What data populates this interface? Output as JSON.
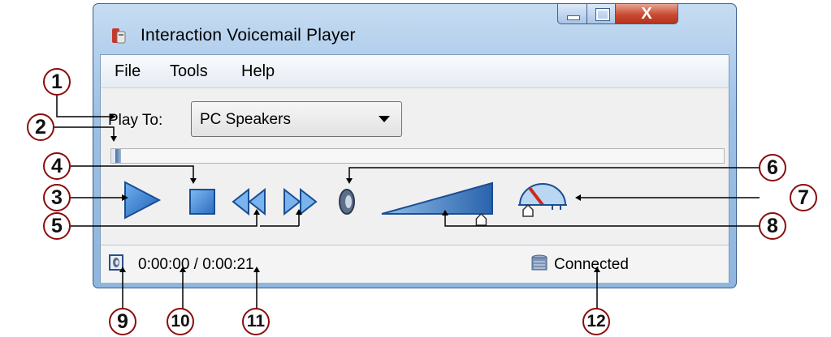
{
  "window": {
    "title": "Interaction Voicemail Player",
    "close_glyph": "X"
  },
  "menu": {
    "items": [
      "File",
      "Tools",
      "Help"
    ]
  },
  "play_to": {
    "label": "Play To:",
    "selected": "PC Speakers"
  },
  "playback": {
    "progress": 0.01,
    "elapsed": "0:00:00",
    "total": "0:00:21",
    "time_text": "0:00:00 / 0:00:21"
  },
  "volume": {
    "level": 0.9
  },
  "status": {
    "connection": "Connected"
  },
  "icons": {
    "app": "voicemail-app-icon",
    "play": "play-icon",
    "stop": "stop-icon",
    "rewind": "rewind-icon",
    "fast_forward": "fast-forward-icon",
    "speaker": "speaker-icon",
    "gain": "gain-meter-icon",
    "status": "speaker-status-icon",
    "server": "server-icon"
  },
  "callouts": [
    "1",
    "2",
    "3",
    "4",
    "5",
    "6",
    "7",
    "8",
    "9",
    "10",
    "11",
    "12"
  ],
  "colors": {
    "accent": "#3a7bd5",
    "callout_border": "#8a0c0c",
    "close": "#c94a32"
  }
}
